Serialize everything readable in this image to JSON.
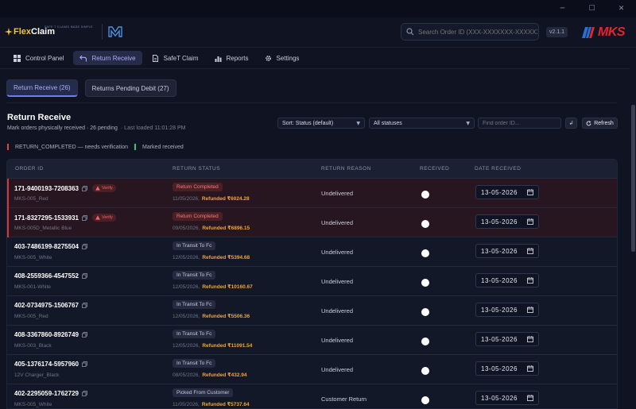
{
  "window": {
    "minimize": "─",
    "maximize": "☐",
    "close": "✕"
  },
  "header": {
    "logo_flex": "Flex",
    "logo_claim": "Claim",
    "logo_tagline": "SAFE T CLAIMS MADE SIMPLE",
    "search_placeholder": "Search Order ID (XXX-XXXXXXX-XXXXXXX)",
    "version": "v2.1.1",
    "brand": "MKS"
  },
  "nav": [
    {
      "label": "Control Panel",
      "icon": "grid-icon"
    },
    {
      "label": "Return Receive",
      "icon": "return-arrow-icon",
      "active": true
    },
    {
      "label": "SafeT Claim",
      "icon": "document-icon"
    },
    {
      "label": "Reports",
      "icon": "bar-chart-icon"
    },
    {
      "label": "Settings",
      "icon": "gear-icon"
    }
  ],
  "subtabs": [
    {
      "label": "Return Receive (26)",
      "active": true
    },
    {
      "label": "Returns Pending Debit (27)"
    }
  ],
  "page": {
    "title": "Return Receive",
    "subtitle": "Mark orders physically received · 26 pending",
    "loaded": "· Last loaded 11:01:28 PM"
  },
  "controls": {
    "sort": "Sort: Status (default)",
    "status": "All statuses",
    "find_placeholder": "Find order ID...",
    "sort_dir": "↲",
    "refresh": "Refresh"
  },
  "legend": [
    {
      "label": "RETURN_COMPLETED — needs verification",
      "color": "#e2453c"
    },
    {
      "label": "Marked received",
      "color": "#3fc07a"
    }
  ],
  "table": {
    "headers": [
      "ORDER ID",
      "RETURN STATUS",
      "RETURN REASON",
      "RECEIVED",
      "DATE RECEIVED"
    ],
    "verify_label": "Verify",
    "rows": [
      {
        "order_id": "171-9400193-7208363",
        "sku": "MKS-005_Red",
        "status": "Return Completed",
        "status_kind": "done",
        "date": "11/05/2026,",
        "refund": "Refunded ₹6024.28",
        "reason": "Undelivered",
        "received_date": "13-05-2026",
        "verify": true
      },
      {
        "order_id": "171-8327295-1533931",
        "sku": "MKS-005D_Metallic Blue",
        "status": "Return Completed",
        "status_kind": "done",
        "date": "09/05/2026,",
        "refund": "Refunded ₹6896.15",
        "reason": "Undelivered",
        "received_date": "13-05-2026",
        "verify": true
      },
      {
        "order_id": "403-7486199-8275504",
        "sku": "MKS-005_White",
        "status": "In Transit To Fc",
        "status_kind": "transit",
        "date": "12/05/2026,",
        "refund": "Refunded ₹5394.68",
        "reason": "Undelivered",
        "received_date": "13-05-2026"
      },
      {
        "order_id": "408-2559366-4547552",
        "sku": "MKS-001-White",
        "status": "In Transit To Fc",
        "status_kind": "transit",
        "date": "12/05/2026,",
        "refund": "Refunded ₹10160.67",
        "reason": "Undelivered",
        "received_date": "13-05-2026"
      },
      {
        "order_id": "402-0734975-1506767",
        "sku": "MKS-005_Red",
        "status": "In Transit To Fc",
        "status_kind": "transit",
        "date": "12/05/2026,",
        "refund": "Refunded ₹5506.36",
        "reason": "Undelivered",
        "received_date": "13-05-2026"
      },
      {
        "order_id": "408-3367860-8926749",
        "sku": "MKS-003_Black",
        "status": "In Transit To Fc",
        "status_kind": "transit",
        "date": "12/05/2026,",
        "refund": "Refunded ₹11091.54",
        "reason": "Undelivered",
        "received_date": "13-05-2026"
      },
      {
        "order_id": "405-1376174-5957960",
        "sku": "12V Charger_Black",
        "status": "In Transit To Fc",
        "status_kind": "transit",
        "date": "08/05/2026,",
        "refund": "Refunded ₹432.94",
        "reason": "Undelivered",
        "received_date": "13-05-2026"
      },
      {
        "order_id": "402-2295059-1762729",
        "sku": "MKS-005_White",
        "status": "Picked From Customer",
        "status_kind": "transit",
        "date": "11/05/2026,",
        "refund": "Refunded ₹5737.64",
        "reason": "Customer Return",
        "received_date": "13-05-2026"
      }
    ]
  },
  "colors": {
    "accent": "#6f7df0",
    "warning": "#e2453c",
    "success": "#3fc07a",
    "refund": "#f0a43a"
  }
}
